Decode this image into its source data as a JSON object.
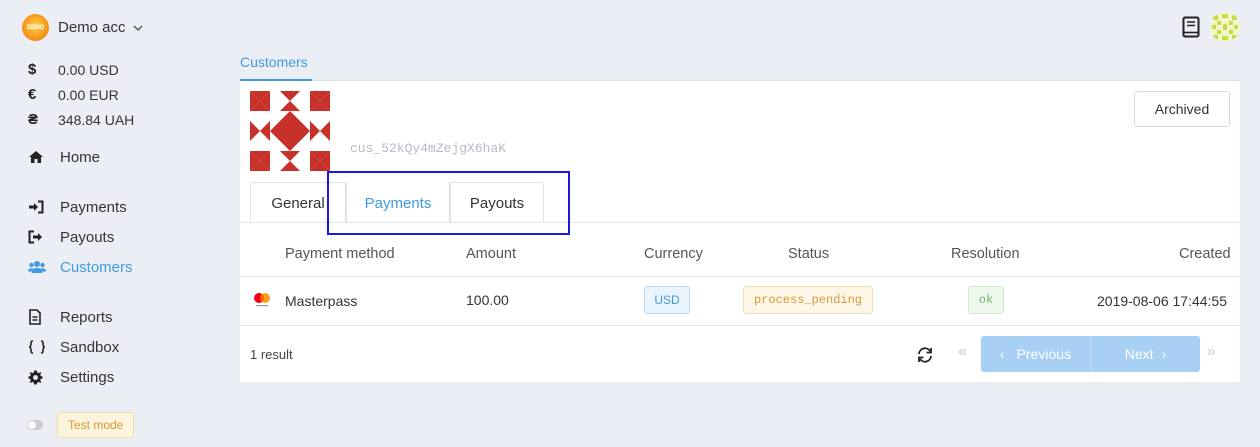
{
  "account": {
    "logo_text": "DEMO",
    "name": "Demo acc"
  },
  "balances": [
    {
      "symbol": "$",
      "value": "0.00 USD"
    },
    {
      "symbol": "€",
      "value": "0.00 EUR"
    },
    {
      "symbol": "₴",
      "value": "348.84 UAH"
    }
  ],
  "nav": {
    "home": "Home",
    "payments": "Payments",
    "payouts": "Payouts",
    "customers": "Customers",
    "reports": "Reports",
    "sandbox": "Sandbox",
    "settings": "Settings"
  },
  "test_mode_label": "Test mode",
  "breadcrumb": "Customers",
  "customer": {
    "id": "cus_52kQy4mZejgX6haK",
    "archived_button": "Archived"
  },
  "tabs": [
    {
      "label": "General"
    },
    {
      "label": "Payments"
    },
    {
      "label": "Payouts"
    }
  ],
  "table": {
    "headers": {
      "payment_method": "Payment method",
      "amount": "Amount",
      "currency": "Currency",
      "status": "Status",
      "resolution": "Resolution",
      "created": "Created"
    },
    "rows": [
      {
        "payment_method": "Masterpass",
        "amount": "100.00",
        "currency": "USD",
        "status": "process_pending",
        "resolution": "ok",
        "created": "2019-08-06 17:44:55"
      }
    ]
  },
  "footer": {
    "result_count": "1 result",
    "previous_label": "Previous",
    "next_label": "Next",
    "first_icon": "«",
    "last_icon": "»"
  },
  "colors": {
    "accent": "#3f9ae2",
    "highlight_box": "#1a1ad8",
    "pattern_red": "#c8302a"
  }
}
